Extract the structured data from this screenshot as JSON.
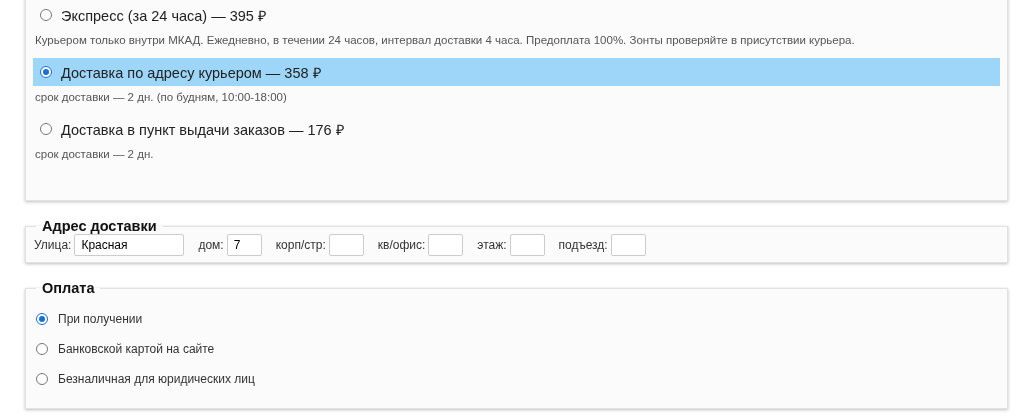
{
  "delivery_options": [
    {
      "title": "Экспресс (за 24 часа) — 395 ₽",
      "note": "Курьером только внутри МКАД. Ежедневно, в течении 24 часов, интервал доставки 4 часа. Предоплата 100%. Зонты проверяйте в присутствии курьера.",
      "selected": false
    },
    {
      "title": "Доставка по адресу курьером — 358 ₽",
      "note": "срок доставки — 2 дн. (по будням, 10:00-18:00)",
      "selected": true
    },
    {
      "title": "Доставка в пункт выдачи заказов — 176 ₽",
      "note": "срок доставки — 2 дн.",
      "selected": false
    }
  ],
  "address": {
    "legend": "Адрес доставки",
    "fields": [
      {
        "label": "Улица:",
        "value": "Красная",
        "kind": "wide"
      },
      {
        "label": "дом:",
        "value": "7",
        "kind": "short"
      },
      {
        "label": "корп/стр:",
        "kind": "short"
      },
      {
        "label": "кв/офис:",
        "kind": "short"
      },
      {
        "label": "этаж:",
        "kind": "short"
      },
      {
        "label": "подъезд:",
        "kind": "short"
      }
    ]
  },
  "payment": {
    "legend": "Оплата",
    "options": [
      {
        "label": "При получении",
        "selected": true
      },
      {
        "label": "Банковской картой на сайте",
        "selected": false
      },
      {
        "label": "Безналичная для юридических лиц",
        "selected": false
      }
    ]
  }
}
